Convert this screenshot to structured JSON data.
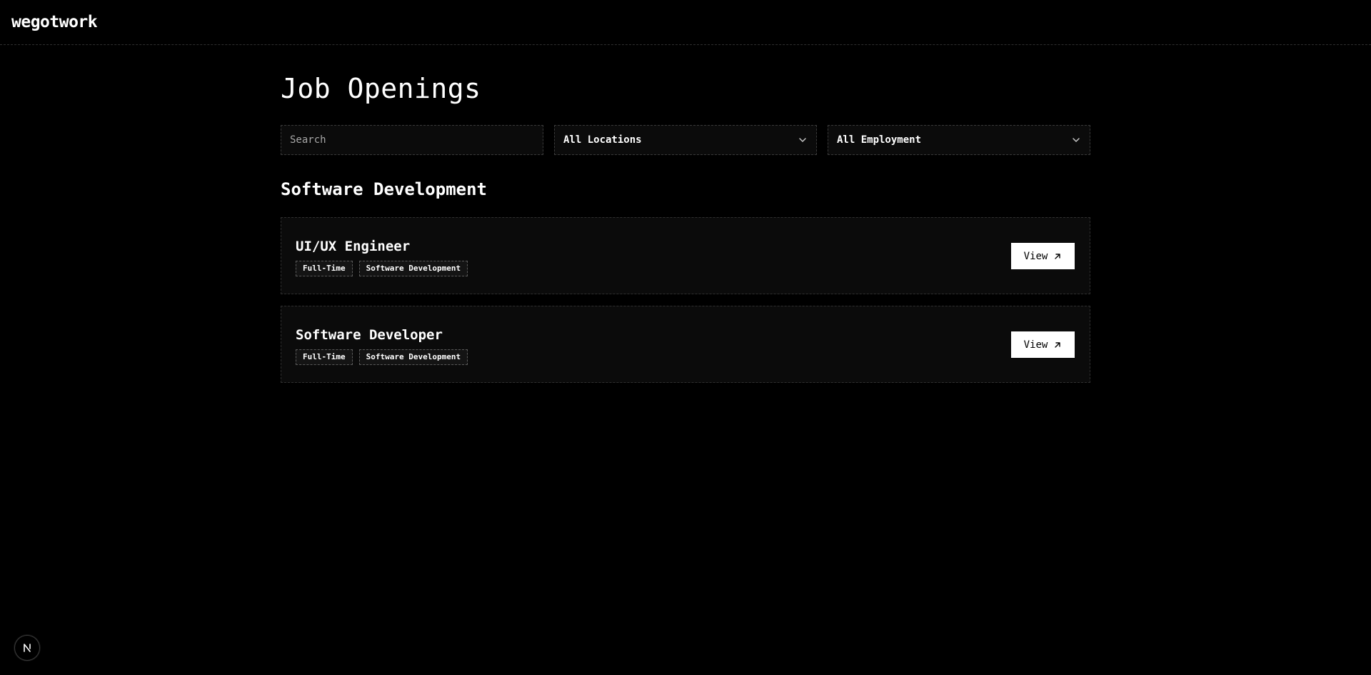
{
  "header": {
    "brand": "wegotwork"
  },
  "page": {
    "title": "Job Openings"
  },
  "filters": {
    "search": {
      "placeholder": "Search",
      "value": ""
    },
    "location": {
      "selected": "All Locations",
      "icon": "chevron-down-icon"
    },
    "employment": {
      "selected": "All Employment",
      "icon": "chevron-down-icon"
    }
  },
  "sections": [
    {
      "title": "Software Development",
      "jobs": [
        {
          "title": "UI/UX Engineer",
          "tags": [
            "Full-Time",
            "Software Development"
          ],
          "action_label": "View",
          "action_icon": "arrow-up-right-icon"
        },
        {
          "title": "Software Developer",
          "tags": [
            "Full-Time",
            "Software Development"
          ],
          "action_label": "View",
          "action_icon": "arrow-up-right-icon"
        }
      ]
    }
  ],
  "dev_indicator": {
    "letter": "N",
    "icon": "nextjs-logo-icon"
  },
  "colors": {
    "background": "#000000",
    "card": "#0b0b0b",
    "text": "#ffffff",
    "border": "#2f2f2f",
    "button_bg": "#ffffff",
    "button_text": "#000000"
  }
}
